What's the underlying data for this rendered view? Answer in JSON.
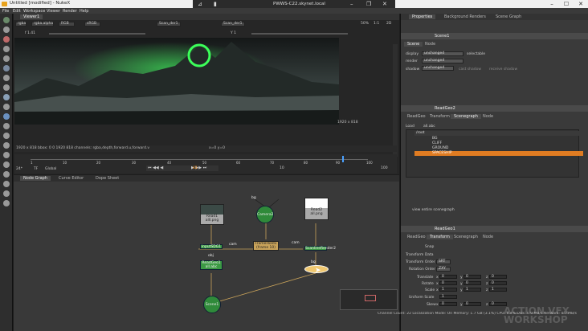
{
  "window": {
    "title": "Untitled [modified] - NukeX"
  },
  "remote": {
    "title": "PWWS-C22.skynet.local"
  },
  "menu": [
    "File",
    "Edit",
    "Workspace",
    "Viewer",
    "Render",
    "Help"
  ],
  "viewer": {
    "tab": "Viewer1",
    "channels": "rgba",
    "layer": "rgba.alpha",
    "colorspace": "RGB",
    "lut": "sRGB",
    "input_a": "Scan_der1",
    "input_b": "Scan_der1",
    "exposure": "f 1.41",
    "gamma": "Y 1",
    "zoom": "50%",
    "ratio": "1:1",
    "mode": "2D",
    "format": "1920 x 818",
    "info": "1920 x 818  bbox: 0 0 1920 818 channels: rgba,depth,forward.u,forward.v",
    "coords": "x=0 y=0"
  },
  "timeline": {
    "fps": "24*",
    "tc": "TF",
    "scope": "Global",
    "frame": "42",
    "ticks": [
      "1",
      "10",
      "20",
      "30",
      "40",
      "50",
      "60",
      "70",
      "80",
      "90",
      "100"
    ],
    "step": "10",
    "end": "100"
  },
  "graph_tabs": [
    "Node Graph",
    "Curve Editor",
    "Dope Sheet"
  ],
  "nodes": {
    "read1": "Read1",
    "read1_file": "alll.png",
    "camera2": "Camera2",
    "read2": "Read2",
    "read2_file": "all.png",
    "snapshot": "inputSDG1",
    "framehold": "FrameHold1",
    "framehold_sub": "(frame 10)",
    "scanline": "ScanlineRender2",
    "readgeo": "ReadGeo1",
    "readgeo_file": "all.abc",
    "scene": "Scene1",
    "cam_label": "cam",
    "cam_label2": "cam",
    "obj_label": "obj",
    "bg_label": "bg",
    "bg_label2": "bg"
  },
  "props": {
    "tabs": [
      "Properties",
      "Background Renders",
      "Scene Graph"
    ],
    "scene_panel": {
      "title": "Scene1",
      "tabs": [
        "Scene",
        "Node"
      ],
      "display_label": "display",
      "display_value": "unchanged",
      "selectable": "selectable",
      "render_label": "render",
      "render_value": "unchanged",
      "shadow_label": "shadow",
      "shadow_value": "unchanged",
      "cast_shadow": "cast shadow",
      "receive_shadow": "receive shadow"
    },
    "readgeo_panel": {
      "title": "ReadGeo2",
      "tabs": [
        "ReadGeo",
        "Transform",
        "Scenegraph",
        "Node"
      ],
      "load": "Load",
      "file": "all.abc",
      "tree": [
        "/root",
        "BG",
        "CLIFF",
        "GROUND",
        "SPACESHIP"
      ],
      "view_entire": "view entire scenegraph"
    },
    "readgeo1_panel": {
      "title": "ReadGeo1",
      "tabs": [
        "ReadGeo",
        "Transform",
        "Scenegraph",
        "Node"
      ],
      "snap": "Snap",
      "transform_data": "Transform Data",
      "transform_order_label": "Transform Order",
      "transform_order": "SRT",
      "rotation_order_label": "Rotation Order",
      "rotation_order": "ZXY",
      "translate": "Translate",
      "rotate": "Rotate",
      "scale": "Scale",
      "uniform_scale": "Uniform Scale",
      "skew": "Skew",
      "x": "x",
      "y": "y",
      "z": "z",
      "v0": "0",
      "v1": "1"
    }
  },
  "status": "Channel Count: 22  Localization Mode: On  Memory: 1.7 GB (3.1%)  CPU: 8.4%  Disk: 0.0 MB/s  Network: 0.0 MB/s",
  "watermark": "ACTION VFX WORKSHOP"
}
